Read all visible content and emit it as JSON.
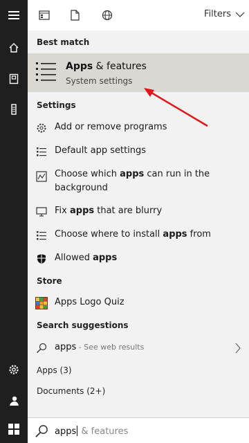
{
  "topbar": {
    "filters_label": "Filters"
  },
  "sections": {
    "best_match": "Best match",
    "settings": "Settings",
    "store": "Store",
    "search_suggestions": "Search suggestions",
    "apps": "Apps (3)",
    "documents": "Documents (2+)"
  },
  "best_match": {
    "title_bold": "Apps",
    "title_rest": " & features",
    "subtitle": "System settings"
  },
  "settings_items": [
    {
      "pre": "Add or remove programs",
      "bold": "",
      "post": ""
    },
    {
      "pre": "Default app settings",
      "bold": "",
      "post": ""
    },
    {
      "pre": "Choose which ",
      "bold": "apps",
      "post": " can run in the background"
    },
    {
      "pre": "Fix ",
      "bold": "apps",
      "post": " that are blurry"
    },
    {
      "pre": "Choose where to install ",
      "bold": "apps",
      "post": " from"
    },
    {
      "pre": "Allowed ",
      "bold": "apps",
      "post": ""
    }
  ],
  "store_item": {
    "label": "Apps Logo Quiz"
  },
  "suggestion": {
    "query": "apps",
    "suffix": " - See web results"
  },
  "search": {
    "typed": "apps",
    "autocomplete": " & features"
  },
  "colors": {
    "rail": "#1f1f1f",
    "highlight": "#d9d8d2",
    "arrow": "#e0161b"
  }
}
